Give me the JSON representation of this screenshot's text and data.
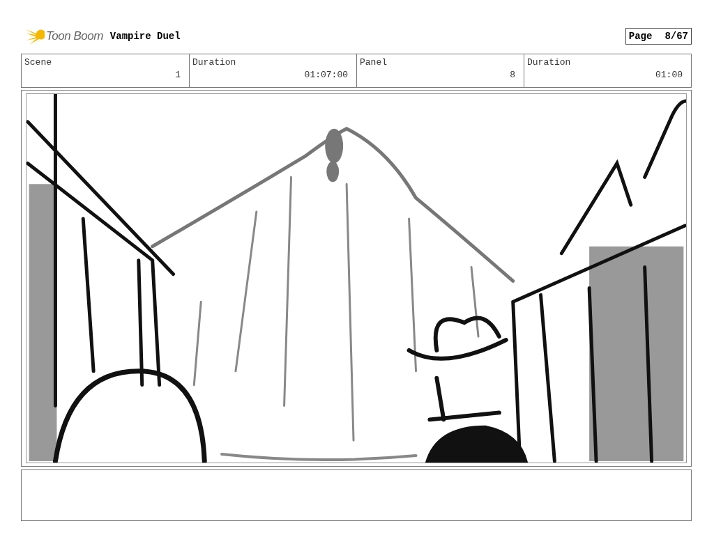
{
  "header": {
    "logo": "Toon Boom",
    "title": "Vampire Duel",
    "page_label": "Page",
    "page_number": "8/67"
  },
  "fields": [
    {
      "label": "Scene",
      "value": "1"
    },
    {
      "label": "Duration",
      "value": "01:07:00"
    },
    {
      "label": "Panel",
      "value": "8"
    },
    {
      "label": "Duration",
      "value": "01:00"
    }
  ]
}
